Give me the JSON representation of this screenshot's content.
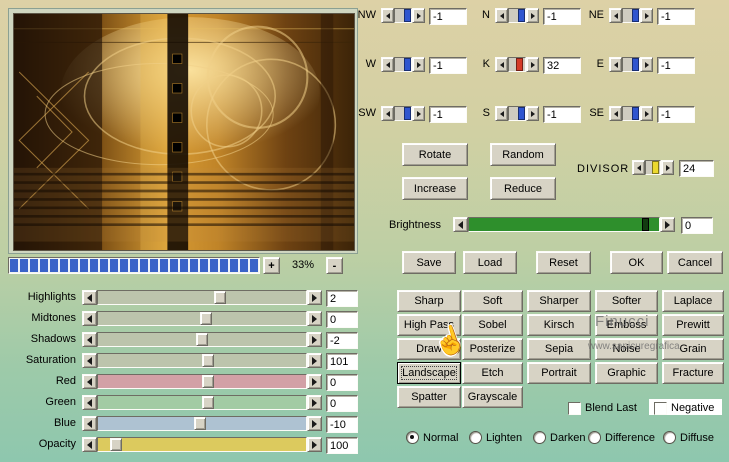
{
  "colors": {
    "bg_top": "#ddd1a6",
    "bg_bottom": "#8ec7ae",
    "button_face": "#d7d3c5",
    "zoom_segment_blue": "#3a63c8",
    "kernel_thumb_blue": "#2f55cf",
    "kernel_thumb_red": "#d43a28",
    "divisor_thumb_yellow": "#ecd92e",
    "track_red": "#d2a0a6",
    "track_green": "#a2cba4",
    "track_blue": "#aec2d2",
    "track_yellow": "#dcca5e",
    "brightness_green": "#2e8f2c"
  },
  "icons": {
    "hand_cursor": "☝"
  },
  "zoom": {
    "plus": "+",
    "percent": "33%",
    "minus": "-"
  },
  "adjust_sliders": [
    {
      "label": "Highlights",
      "value": "2"
    },
    {
      "label": "Midtones",
      "value": "0"
    },
    {
      "label": "Shadows",
      "value": "-2"
    },
    {
      "label": "Saturation",
      "value": "101"
    },
    {
      "label": "Red",
      "value": "0"
    },
    {
      "label": "Green",
      "value": "0"
    },
    {
      "label": "Blue",
      "value": "-10"
    },
    {
      "label": "Opacity",
      "value": "100"
    }
  ],
  "kernel_cells": [
    {
      "label": "NW",
      "value": "-1"
    },
    {
      "label": "N",
      "value": "-1"
    },
    {
      "label": "NE",
      "value": "-1"
    },
    {
      "label": "W",
      "value": "-1"
    },
    {
      "label": "K",
      "value": "32"
    },
    {
      "label": "E",
      "value": "-1"
    },
    {
      "label": "SW",
      "value": "-1"
    },
    {
      "label": "S",
      "value": "-1"
    },
    {
      "label": "SE",
      "value": "-1"
    }
  ],
  "controls": {
    "rotate": "Rotate",
    "random": "Random",
    "increase": "Increase",
    "reduce": "Reduce",
    "divisor_label": "DIVISOR",
    "divisor_value": "24",
    "brightness_label": "Brightness",
    "brightness_value": "0"
  },
  "actions": {
    "save": "Save",
    "load": "Load",
    "reset": "Reset",
    "ok": "OK",
    "cancel": "Cancel"
  },
  "filters": [
    "Sharp",
    "Soft",
    "Sharper",
    "Softer",
    "Laplace",
    "High Pass",
    "Sobel",
    "Kirsch",
    "Emboss",
    "Prewitt",
    "Draw",
    "Posterize",
    "Sepia",
    "Noise",
    "Grain",
    "Landscape",
    "Etch",
    "Portrait",
    "Graphic",
    "Fracture",
    "Spatter",
    "Grayscale"
  ],
  "checkboxes": [
    {
      "label": "Blend Last",
      "checked": false
    },
    {
      "label": "Negative",
      "checked": false
    }
  ],
  "blend_modes": [
    {
      "label": "Normal",
      "selected": true
    },
    {
      "label": "Lighten",
      "selected": false
    },
    {
      "label": "Darken",
      "selected": false
    },
    {
      "label": "Difference",
      "selected": false
    },
    {
      "label": "Diffuse",
      "selected": false
    }
  ],
  "watermark": {
    "line1": "Finucci",
    "line2": "www.sapicuregrafica"
  }
}
